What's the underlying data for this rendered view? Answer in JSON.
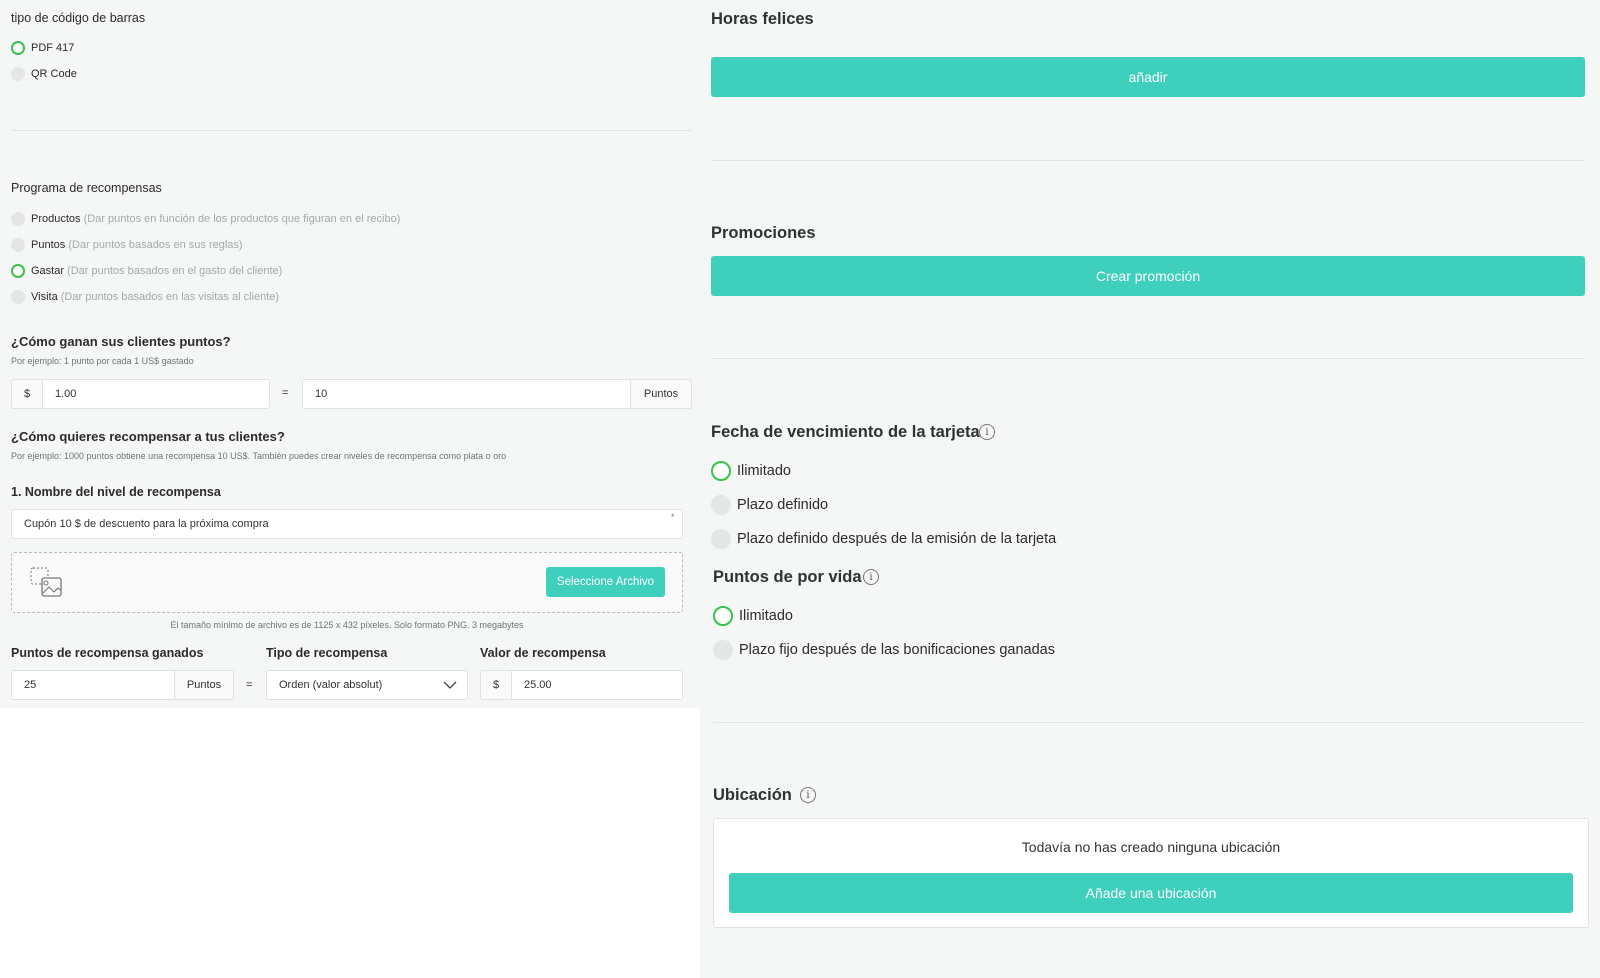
{
  "barcode": {
    "title": "tipo de código de barras",
    "options": [
      {
        "label": "PDF 417",
        "selected": true
      },
      {
        "label": "QR Code",
        "selected": false
      }
    ]
  },
  "rewards_program": {
    "title": "Programa de recompensas",
    "options": [
      {
        "label": "Productos",
        "hint": "(Dar puntos en función de los productos que figuran en el recibo)",
        "selected": false
      },
      {
        "label": "Puntos",
        "hint": "(Dar puntos basados en sus reglas)",
        "selected": false
      },
      {
        "label": "Gastar",
        "hint": "(Dar puntos basados en el gasto del cliente)",
        "selected": true
      },
      {
        "label": "Visita",
        "hint": "(Dar puntos basados en las visitas al cliente)",
        "selected": false
      }
    ]
  },
  "earn": {
    "title": "¿Cómo ganan sus clientes puntos?",
    "hint": "Por ejemplo: 1 punto por cada 1 US$ gastado",
    "currency": "$",
    "amount": "1.00",
    "equals": "=",
    "points": "10",
    "points_suffix": "Puntos"
  },
  "reward": {
    "title": "¿Cómo quieres recompensar a tus clientes?",
    "hint": "Por ejemplo: 1000 puntos obtiene una recompensa 10 US$. También puedes crear niveles de recompensa como plata o oro",
    "level_label": "1. Nombre del nivel de recompensa",
    "level_value": "Cupón 10 $ de descuento para la próxima compra",
    "required_mark": "*",
    "upload_button": "Seleccione Archivo",
    "upload_hint": "El tamaño mínimo de archivo es de 1125 x 432 píxeles. Solo formato PNG. 3 megabytes",
    "points_label": "Puntos de recompensa ganados",
    "points_value": "25",
    "points_suffix": "Puntos",
    "equals": "=",
    "type_label": "Tipo de recompensa",
    "type_value": "Orden (valor absolut)",
    "value_label": "Valor de recompensa",
    "value_currency": "$",
    "value_amount": "25.00"
  },
  "happy_hours": {
    "title": "Horas felices",
    "button": "añadir"
  },
  "promotions": {
    "title": "Promociones",
    "button": "Crear promoción"
  },
  "card_expiry": {
    "title": "Fecha de vencimiento de la tarjeta",
    "options": [
      {
        "label": "Ilimitado",
        "selected": true
      },
      {
        "label": "Plazo definido",
        "selected": false
      },
      {
        "label": "Plazo definido después de la emisión de la tarjeta",
        "selected": false
      }
    ]
  },
  "lifetime_points": {
    "title": "Puntos de por vida",
    "options": [
      {
        "label": "Ilimitado",
        "selected": true
      },
      {
        "label": "Plazo fijo después de las bonificaciones ganadas",
        "selected": false
      }
    ]
  },
  "location": {
    "title": "Ubicación",
    "empty_text": "Todavía no has creado ninguna ubicación",
    "button": "Añade una ubicación"
  },
  "colors": {
    "accent": "#3ecfbd",
    "radio_selected": "#38c24a",
    "panel_bg": "#f5f6f6"
  },
  "icons": {
    "info": "info-icon",
    "upload": "image-upload-icon",
    "dropdown": "chevron-down-icon"
  }
}
